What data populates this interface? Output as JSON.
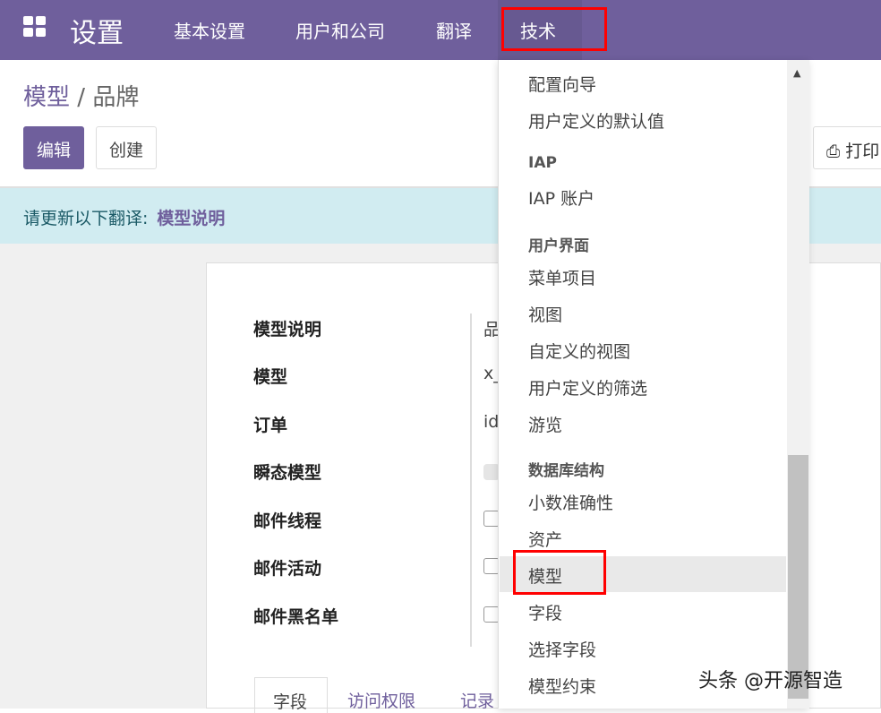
{
  "navbar": {
    "app_title": "设置",
    "menu": [
      "基本设置",
      "用户和公司",
      "翻译",
      "技术"
    ],
    "active": "技术",
    "icon": "apps-grid-icon"
  },
  "breadcrumb": {
    "parent": "模型",
    "separator": "/",
    "current": "品牌"
  },
  "toolbar": {
    "edit": "编辑",
    "create": "创建",
    "print": "打印"
  },
  "alert": {
    "text": "请更新以下翻译:",
    "link": "模型说明"
  },
  "form": {
    "labels": [
      "模型说明",
      "模型",
      "订单",
      "瞬态模型",
      "邮件线程",
      "邮件活动",
      "邮件黑名单"
    ],
    "values": [
      "品",
      "x_",
      "id"
    ],
    "tabs": [
      "字段",
      "访问权限",
      "记录"
    ]
  },
  "dropdown": {
    "items": [
      {
        "type": "item",
        "label": "配置向导"
      },
      {
        "type": "item",
        "label": "用户定义的默认值"
      },
      {
        "type": "header",
        "label": "IAP"
      },
      {
        "type": "item",
        "label": "IAP 账户"
      },
      {
        "type": "header",
        "label": "用户界面"
      },
      {
        "type": "item",
        "label": "菜单项目"
      },
      {
        "type": "item",
        "label": "视图"
      },
      {
        "type": "item",
        "label": "自定义的视图"
      },
      {
        "type": "item",
        "label": "用户定义的筛选"
      },
      {
        "type": "item",
        "label": "游览"
      },
      {
        "type": "header",
        "label": "数据库结构"
      },
      {
        "type": "item",
        "label": "小数准确性"
      },
      {
        "type": "item",
        "label": "资产"
      },
      {
        "type": "item",
        "label": "模型",
        "highlighted": true
      },
      {
        "type": "item",
        "label": "字段"
      },
      {
        "type": "item",
        "label": "选择字段"
      },
      {
        "type": "item",
        "label": "模型约束"
      }
    ]
  },
  "watermark": "头条 @开源智造",
  "colors": {
    "brand": "#6f5f9c",
    "alert_bg": "#d1ecf1",
    "highlight_box": "#ff0000"
  }
}
